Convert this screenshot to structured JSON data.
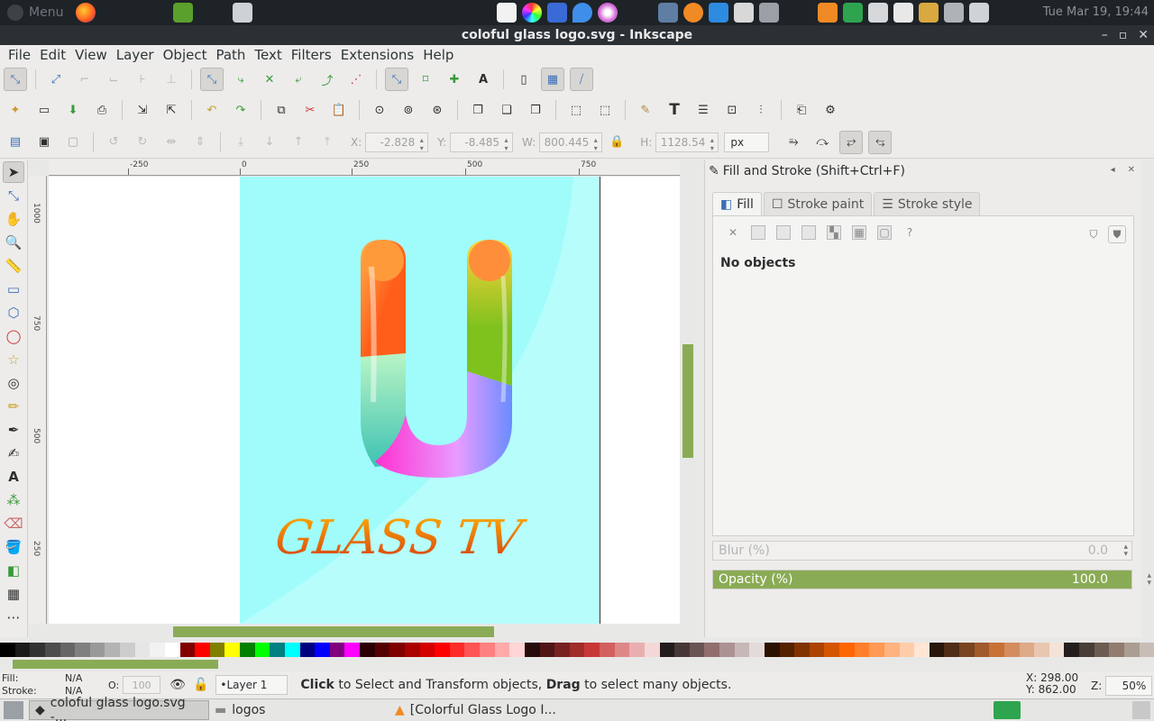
{
  "system_panel": {
    "menu_label": "Menu",
    "clock": "Tue Mar 19, 19:44",
    "launcher_icons": [
      "firefox-icon",
      "music-icon",
      "screenshot-icon"
    ],
    "tray_icons": [
      "files-icon",
      "color-picker-icon",
      "package-icon",
      "drop-icon",
      "disc-icon",
      "arrows-icon",
      "blender-icon",
      "feather-icon",
      "inkscape-icon",
      "robot-icon",
      "vlc-icon",
      "bluetooth-icon",
      "network-icon",
      "mail-icon",
      "updates-icon",
      "volume-icon",
      "display-icon"
    ]
  },
  "window": {
    "title": "coloful glass logo.svg - Inkscape"
  },
  "menubar": [
    "File",
    "Edit",
    "View",
    "Layer",
    "Object",
    "Path",
    "Text",
    "Filters",
    "Extensions",
    "Help"
  ],
  "control_bar": {
    "x_label": "X:",
    "x_value": "-2.828",
    "y_label": "Y:",
    "y_value": "-8.485",
    "w_label": "W:",
    "w_value": "800.445",
    "h_label": "H:",
    "h_value": "1128.54",
    "unit": "px"
  },
  "ruler": {
    "labels": [
      "-250",
      "0",
      "250",
      "500",
      "750"
    ],
    "vertical_labels": [
      "1000",
      "750",
      "500",
      "250"
    ]
  },
  "artwork": {
    "logo_text": "GLASS TV",
    "colors": {
      "page_bg": "#9ffcfb",
      "orange": "#ff7d1a",
      "green": "#6bb21e",
      "magenta": "#ff2fd0",
      "lavender": "#c9b8ff",
      "teal": "#6fe0c4",
      "text_orange": "#e2781a"
    }
  },
  "dock": {
    "title": "Fill and Stroke (Shift+Ctrl+F)",
    "tabs": [
      "Fill",
      "Stroke paint",
      "Stroke style"
    ],
    "empty_message": "No objects",
    "blur_label": "Blur (%)",
    "blur_value": "0.0",
    "opacity_label": "Opacity (%)",
    "opacity_value": "100.0"
  },
  "palette": {
    "swatches": [
      "#000000",
      "#1a1a1a",
      "#333333",
      "#4d4d4d",
      "#666666",
      "#808080",
      "#999999",
      "#b3b3b3",
      "#cccccc",
      "#e6e6e6",
      "#f2f2f2",
      "#ffffff",
      "#800000",
      "#ff0000",
      "#808000",
      "#ffff00",
      "#008000",
      "#00ff00",
      "#008080",
      "#00ffff",
      "#000080",
      "#0000ff",
      "#800080",
      "#ff00ff",
      "#2b0000",
      "#550000",
      "#800000",
      "#aa0000",
      "#d40000",
      "#ff0000",
      "#ff2a2a",
      "#ff5555",
      "#ff8080",
      "#ffaaaa",
      "#ffd5d5",
      "#280b0b",
      "#501616",
      "#782121",
      "#a02c2c",
      "#c83737",
      "#d35f5f",
      "#de8787",
      "#e9afaf",
      "#f4d7d7",
      "#241c1c",
      "#483737",
      "#6c5353",
      "#916f6f",
      "#ac9393",
      "#c8b7b7",
      "#e3dbdb",
      "#2b1100",
      "#552200",
      "#803300",
      "#aa4400",
      "#d45500",
      "#ff6600",
      "#ff7f2a",
      "#ff9955",
      "#ffb380",
      "#ffccaa",
      "#ffe6d5",
      "#28170b",
      "#502d16",
      "#784421",
      "#a05a2c",
      "#c87137",
      "#d38d5f",
      "#deaa87",
      "#e9c6af",
      "#f4e3d7",
      "#241f1c",
      "#483e37",
      "#6c5d53",
      "#917c6f",
      "#ac9d93",
      "#c8beb7"
    ]
  },
  "statusbar": {
    "fill_label": "Fill:",
    "fill_value": "N/A",
    "stroke_label": "Stroke:",
    "stroke_value": "N/A",
    "opacity_label": "O:",
    "opacity_value": "100",
    "layer": "•Layer 1",
    "message_click": "Click",
    "message_mid": " to Select and Transform objects, ",
    "message_drag": "Drag",
    "message_end": " to select many objects.",
    "x_label": "X:",
    "x": "298.00",
    "y_label": "Y:",
    "y": "862.00",
    "zoom_label": "Z:",
    "zoom": "50%"
  },
  "taskbar": {
    "items": [
      "coloful glass logo.svg -...",
      "logos",
      "[Colorful Glass Logo   I..."
    ]
  }
}
